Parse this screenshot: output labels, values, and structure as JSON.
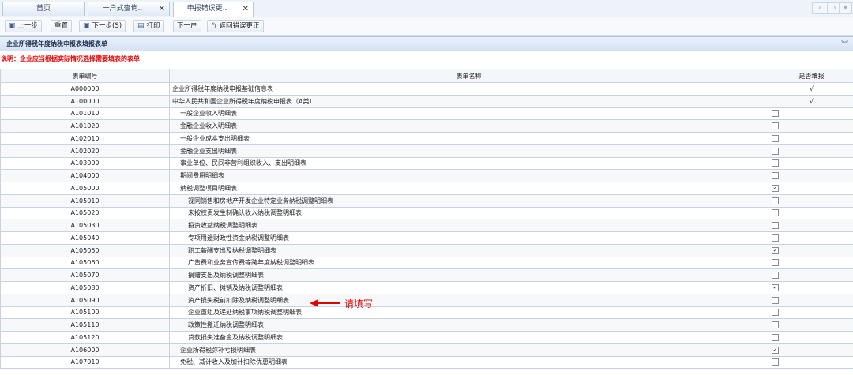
{
  "tabs": [
    {
      "label": "首页",
      "closable": false
    },
    {
      "label": "一户式查询..",
      "closable": true
    },
    {
      "label": "申报错误更..",
      "closable": true,
      "active": true
    }
  ],
  "nav": {
    "prev": "‹",
    "next": "›",
    "more": "▾"
  },
  "toolbar": {
    "prev_step": "上一步",
    "reset": "重置",
    "next_step": "下一步(S)",
    "print": "打印",
    "next_household": "下一户",
    "back": "返回错误更正"
  },
  "section": {
    "title": "企业所得税年度纳税申报表填报表单"
  },
  "note": "说明：企业应当根据实际情况选择需要填表的表单",
  "table": {
    "headers": [
      "表单编号",
      "表单名称",
      "是否填报"
    ],
    "rows": [
      {
        "code": "A000000",
        "name": "企业所得税年度纳税申报基础信息表",
        "level": 0,
        "fill": "tick"
      },
      {
        "code": "A100000",
        "name": "中华人民共和国企业所得税年度纳税申报表（A类）",
        "level": 0,
        "fill": "tick"
      },
      {
        "code": "A101010",
        "name": "一般企业收入明细表",
        "level": 1,
        "fill": "unchecked"
      },
      {
        "code": "A101020",
        "name": "金融企业收入明细表",
        "level": 1,
        "fill": "unchecked"
      },
      {
        "code": "A102010",
        "name": "一般企业成本支出明细表",
        "level": 1,
        "fill": "unchecked"
      },
      {
        "code": "A102020",
        "name": "金融企业支出明细表",
        "level": 1,
        "fill": "unchecked"
      },
      {
        "code": "A103000",
        "name": "事业单位、民间非营利组织收入、支出明细表",
        "level": 1,
        "fill": "unchecked"
      },
      {
        "code": "A104000",
        "name": "期间费用明细表",
        "level": 1,
        "fill": "unchecked"
      },
      {
        "code": "A105000",
        "name": "纳税调整项目明细表",
        "level": 1,
        "fill": "checked"
      },
      {
        "code": "A105010",
        "name": "视同销售和房地产开发企业特定业务纳税调整明细表",
        "level": 2,
        "fill": "unchecked"
      },
      {
        "code": "A105020",
        "name": "未按权责发生制确认收入纳税调整明细表",
        "level": 2,
        "fill": "unchecked"
      },
      {
        "code": "A105030",
        "name": "投资收益纳税调整明细表",
        "level": 2,
        "fill": "unchecked"
      },
      {
        "code": "A105040",
        "name": "专项用途财政性资金纳税调整明细表",
        "level": 2,
        "fill": "unchecked"
      },
      {
        "code": "A105050",
        "name": "职工薪酬支出及纳税调整明细表",
        "level": 2,
        "fill": "checked"
      },
      {
        "code": "A105060",
        "name": "广告费和业务宣传费等跨年度纳税调整明细表",
        "level": 2,
        "fill": "unchecked"
      },
      {
        "code": "A105070",
        "name": "捐赠支出及纳税调整明细表",
        "level": 2,
        "fill": "unchecked"
      },
      {
        "code": "A105080",
        "name": "资产折旧、摊销及纳税调整明细表",
        "level": 2,
        "fill": "checked"
      },
      {
        "code": "A105090",
        "name": "资产损失税前扣除及纳税调整明细表",
        "level": 2,
        "fill": "unchecked"
      },
      {
        "code": "A105100",
        "name": "企业重组及递延纳税事项纳税调整明细表",
        "level": 2,
        "fill": "unchecked"
      },
      {
        "code": "A105110",
        "name": "政策性搬迁纳税调整明细表",
        "level": 2,
        "fill": "unchecked"
      },
      {
        "code": "A105120",
        "name": "贷款损失准备金及纳税调整明细表",
        "level": 2,
        "fill": "unchecked"
      },
      {
        "code": "A106000",
        "name": "企业所得税弥补亏损明细表",
        "level": 1,
        "fill": "checked"
      },
      {
        "code": "A107010",
        "name": "免税、减计收入及加计扣除优惠明细表",
        "level": 1,
        "fill": "unchecked"
      }
    ]
  },
  "annotation": {
    "text": "请填写"
  },
  "colors": {
    "note": "#e60000",
    "annotation": "#e00000",
    "titlebar": "#d4e2f3"
  }
}
